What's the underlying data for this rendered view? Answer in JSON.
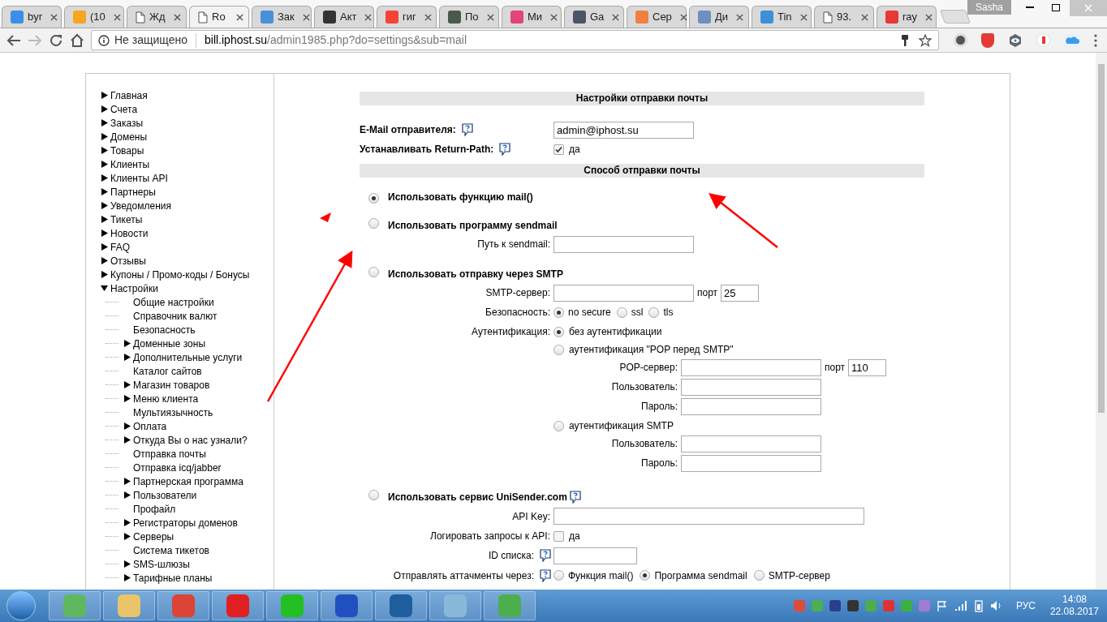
{
  "browser": {
    "tabs": [
      {
        "label": "byr",
        "selected": false,
        "kind": "site",
        "color": "#3d8ee6"
      },
      {
        "label": "(10",
        "selected": false,
        "kind": "site",
        "color": "#f5a623"
      },
      {
        "label": "Жд",
        "selected": false,
        "kind": "page"
      },
      {
        "label": "Ro",
        "selected": true,
        "kind": "page"
      },
      {
        "label": "Зак",
        "selected": false,
        "kind": "site",
        "color": "#4a90d9"
      },
      {
        "label": "Акт",
        "selected": false,
        "kind": "site",
        "color": "#333333"
      },
      {
        "label": "гиг",
        "selected": false,
        "kind": "site",
        "color": "#f44336"
      },
      {
        "label": "По",
        "selected": false,
        "kind": "site",
        "color": "#4a5a4a"
      },
      {
        "label": "Ми",
        "selected": false,
        "kind": "site",
        "color": "#e0457b"
      },
      {
        "label": "Ga",
        "selected": false,
        "kind": "site",
        "color": "#4b5566"
      },
      {
        "label": "Cep",
        "selected": false,
        "kind": "site",
        "color": "#f08040"
      },
      {
        "label": "Ди",
        "selected": false,
        "kind": "site",
        "color": "#6d8fc2"
      },
      {
        "label": "Tin",
        "selected": false,
        "kind": "site",
        "color": "#3e8fd8"
      },
      {
        "label": "93.",
        "selected": false,
        "kind": "page"
      },
      {
        "label": "ray",
        "selected": false,
        "kind": "site",
        "color": "#e53935"
      }
    ],
    "profile": "Sasha",
    "address": {
      "security": "Не защищено",
      "host": "bill.iphost.su",
      "path": "/admin1985.php?do=settings&sub=mail"
    }
  },
  "sidebar": {
    "items": [
      {
        "label": "Главная",
        "expanded": false
      },
      {
        "label": "Счета",
        "expanded": false
      },
      {
        "label": "Заказы",
        "expanded": false
      },
      {
        "label": "Домены",
        "expanded": false
      },
      {
        "label": "Товары",
        "expanded": false
      },
      {
        "label": "Клиенты",
        "expanded": false
      },
      {
        "label": "Клиенты API",
        "expanded": false
      },
      {
        "label": "Партнеры",
        "expanded": false
      },
      {
        "label": "Уведомления",
        "expanded": false
      },
      {
        "label": "Тикеты",
        "expanded": false
      },
      {
        "label": "Новости",
        "expanded": false
      },
      {
        "label": "FAQ",
        "expanded": false
      },
      {
        "label": "Отзывы",
        "expanded": false
      },
      {
        "label": "Купоны / Промо-коды / Бонусы",
        "expanded": false
      },
      {
        "label": "Настройки",
        "expanded": true,
        "children": [
          {
            "label": "Общие настройки",
            "kind": "page"
          },
          {
            "label": "Справочник валют",
            "kind": "page"
          },
          {
            "label": "Безопасность",
            "kind": "page"
          },
          {
            "label": "Доменные зоны",
            "kind": "folder",
            "expanded": false
          },
          {
            "label": "Дополнительные услуги",
            "kind": "folder",
            "expanded": false
          },
          {
            "label": "Каталог сайтов",
            "kind": "page"
          },
          {
            "label": "Магазин товаров",
            "kind": "folder",
            "expanded": false
          },
          {
            "label": "Меню клиента",
            "kind": "folder",
            "expanded": false
          },
          {
            "label": "Мультиязычность",
            "kind": "page"
          },
          {
            "label": "Оплата",
            "kind": "folder",
            "expanded": false
          },
          {
            "label": "Откуда Вы о нас узнали?",
            "kind": "folder",
            "expanded": false
          },
          {
            "label": "Отправка почты",
            "kind": "page"
          },
          {
            "label": "Отправка icq/jabber",
            "kind": "page"
          },
          {
            "label": "Партнерская программа",
            "kind": "folder",
            "expanded": false
          },
          {
            "label": "Пользователи",
            "kind": "folder",
            "expanded": false
          },
          {
            "label": "Профайл",
            "kind": "page"
          },
          {
            "label": "Регистраторы доменов",
            "kind": "folder",
            "expanded": false
          },
          {
            "label": "Серверы",
            "kind": "folder",
            "expanded": false
          },
          {
            "label": "Система тикетов",
            "kind": "page"
          },
          {
            "label": "SMS-шлюзы",
            "kind": "folder",
            "expanded": false
          },
          {
            "label": "Тарифные планы",
            "kind": "folder",
            "expanded": false
          }
        ]
      }
    ]
  },
  "form": {
    "general": {
      "title": "Настройки отправки почты",
      "sender": {
        "label": "E-Mail отправителя:",
        "help": true,
        "value": "admin@iphost.su"
      },
      "return_path": {
        "label": "Устанавливать Return-Path:",
        "help": true,
        "checked": true,
        "text": "да"
      }
    },
    "method": {
      "title": "Способ отправки почты",
      "options": [
        {
          "kind": "mail",
          "label": "Использовать функцию mail()",
          "selected": true
        },
        {
          "kind": "sendmail",
          "label": "Использовать программу sendmail",
          "selected": false,
          "path_label": "Путь к sendmail:"
        },
        {
          "kind": "smtp",
          "label": "Использовать отправку через SMTP",
          "selected": false,
          "server_label": "SMTP-сервер:",
          "port_label": "порт",
          "port": "25",
          "security": {
            "label": "Безопасность:",
            "options": [
              {
                "label": "no secure",
                "selected": true
              },
              {
                "label": "ssl",
                "selected": false
              },
              {
                "label": "tls",
                "selected": false
              }
            ]
          },
          "auth": {
            "label": "Аутентификация:",
            "options": [
              {
                "label": "без аутентификации",
                "selected": true
              },
              {
                "label": "аутентификация \"POP перед SMTP\"",
                "selected": false,
                "fields": [
                  {
                    "label": "POP-сервер:",
                    "port_label": "порт",
                    "port": "110"
                  },
                  {
                    "label": "Пользователь:"
                  },
                  {
                    "label": "Пароль:"
                  }
                ]
              },
              {
                "label": "аутентификация SMTP",
                "selected": false,
                "fields": [
                  {
                    "label": "Пользователь:"
                  },
                  {
                    "label": "Пароль:"
                  }
                ]
              }
            ]
          }
        },
        {
          "kind": "unisender",
          "label": "Использовать сервис UniSender.com",
          "help": true,
          "selected": false,
          "api_key_label": "API Key:",
          "log": {
            "label": "Логировать запросы к API:",
            "checked": false,
            "text": "да"
          },
          "list_id": {
            "label": "ID списка:",
            "help": true
          },
          "attachments": {
            "label": "Отправлять аттачменты через:",
            "help": true,
            "options": [
              {
                "label": "Функция mail()",
                "selected": false
              },
              {
                "label": "Программа sendmail",
                "selected": true
              },
              {
                "label": "SMTP-сервер",
                "selected": false
              }
            ]
          }
        }
      ]
    }
  },
  "taskbar": {
    "language": "РУС",
    "time": "14:08",
    "date": "22.08.2017"
  }
}
